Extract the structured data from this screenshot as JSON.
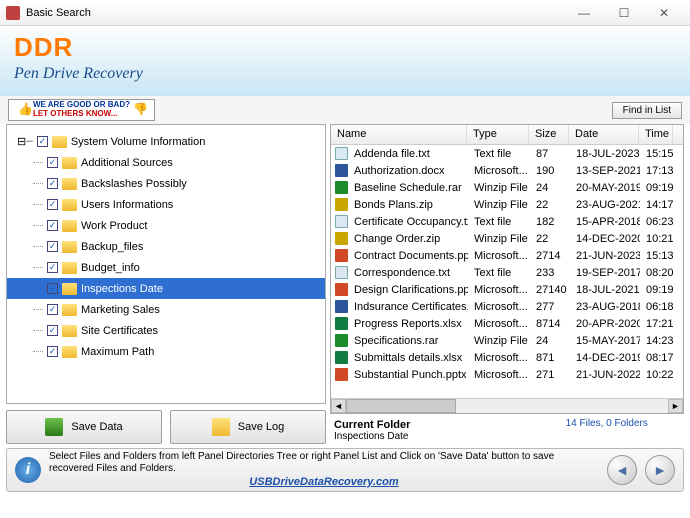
{
  "window": {
    "title": "Basic Search"
  },
  "header": {
    "brand": "DDR",
    "subtitle": "Pen Drive Recovery"
  },
  "toolbar": {
    "feedback_l1": "WE ARE GOOD OR BAD?",
    "feedback_l2": "LET OTHERS KNOW...",
    "find_label": "Find in List"
  },
  "tree": {
    "root": "System Volume Information",
    "items": [
      "Additional Sources",
      "Backslashes Possibly",
      "Users Informations",
      "Work Product",
      "Backup_files",
      "Budget_info",
      "Inspections Date",
      "Marketing Sales",
      "Site Certificates",
      "Maximum Path"
    ],
    "selected_index": 6
  },
  "actions": {
    "save_data": "Save Data",
    "save_log": "Save Log"
  },
  "filelist": {
    "columns": {
      "name": "Name",
      "type": "Type",
      "size": "Size",
      "date": "Date",
      "time": "Time"
    },
    "rows": [
      {
        "icon": "txt",
        "name": "Addenda file.txt",
        "type": "Text file",
        "size": "87",
        "date": "18-JUL-2023",
        "time": "15:15"
      },
      {
        "icon": "doc",
        "name": "Authorization.docx",
        "type": "Microsoft...",
        "size": "190",
        "date": "13-SEP-2021",
        "time": "17:13"
      },
      {
        "icon": "rar",
        "name": "Baseline Schedule.rar",
        "type": "Winzip File",
        "size": "24",
        "date": "20-MAY-2019",
        "time": "09:19"
      },
      {
        "icon": "zip",
        "name": "Bonds Plans.zip",
        "type": "Winzip File",
        "size": "22",
        "date": "23-AUG-2021",
        "time": "14:17"
      },
      {
        "icon": "txt",
        "name": "Certificate Occupancy.txt",
        "type": "Text file",
        "size": "182",
        "date": "15-APR-2018",
        "time": "06:23"
      },
      {
        "icon": "zip",
        "name": "Change Order.zip",
        "type": "Winzip File",
        "size": "22",
        "date": "14-DEC-2020",
        "time": "10:21"
      },
      {
        "icon": "ppt",
        "name": "Contract Documents.pptx",
        "type": "Microsoft...",
        "size": "2714",
        "date": "21-JUN-2023",
        "time": "15:13"
      },
      {
        "icon": "txt",
        "name": "Correspondence.txt",
        "type": "Text file",
        "size": "233",
        "date": "19-SEP-2017",
        "time": "08:20"
      },
      {
        "icon": "ppt",
        "name": "Design Clarifications.pptx",
        "type": "Microsoft...",
        "size": "27140",
        "date": "18-JUL-2021",
        "time": "09:19"
      },
      {
        "icon": "doc",
        "name": "Indsurance Certificates.d...",
        "type": "Microsoft...",
        "size": "277",
        "date": "23-AUG-2018",
        "time": "06:18"
      },
      {
        "icon": "xls",
        "name": "Progress Reports.xlsx",
        "type": "Microsoft...",
        "size": "8714",
        "date": "20-APR-2020",
        "time": "17:21"
      },
      {
        "icon": "rar",
        "name": "Specifications.rar",
        "type": "Winzip File",
        "size": "24",
        "date": "15-MAY-2017",
        "time": "14:23"
      },
      {
        "icon": "xls",
        "name": "Submittals details.xlsx",
        "type": "Microsoft...",
        "size": "871",
        "date": "14-DEC-2019",
        "time": "08:17"
      },
      {
        "icon": "ppt",
        "name": "Substantial Punch.pptx",
        "type": "Microsoft...",
        "size": "271",
        "date": "21-JUN-2022",
        "time": "10:22"
      }
    ],
    "status": "14 Files, 0 Folders",
    "current_folder_title": "Current Folder",
    "current_folder_value": "Inspections Date"
  },
  "footer": {
    "message": "Select Files and Folders from left Panel Directories Tree or right Panel List and Click on 'Save Data' button to save recovered Files and Folders.",
    "url": "USBDriveDataRecovery.com"
  }
}
